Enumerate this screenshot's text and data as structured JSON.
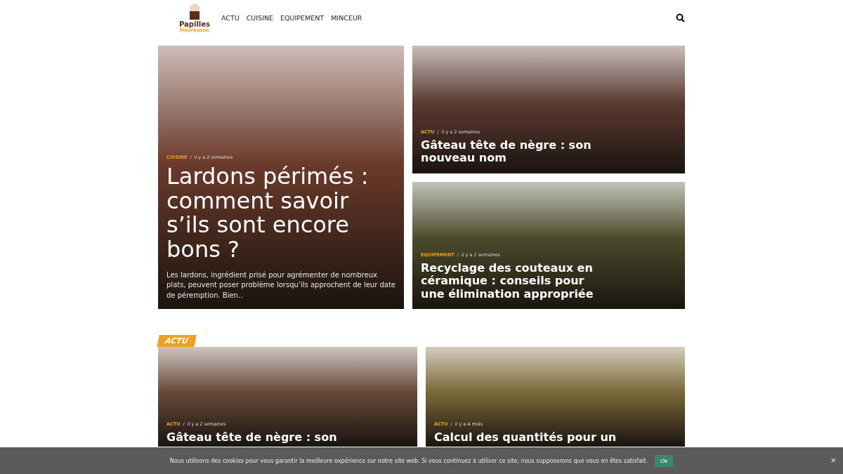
{
  "header": {
    "logo": {
      "line1": "Papilles",
      "line2": "Heureuses"
    },
    "nav": [
      {
        "label": "ACTU"
      },
      {
        "label": "CUISINE"
      },
      {
        "label": "EQUIPEMENT"
      },
      {
        "label": "MINCEUR"
      }
    ]
  },
  "featured": [
    {
      "category": "CUISINE",
      "separator": "/",
      "time": "il y a 2 semaines",
      "title": "Lardons périmés : comment savoir s’ils sont encore bons ?",
      "excerpt": "Les lardons, ingrédient prisé pour agrémenter de nombreux plats, peuvent poser problème lorsqu’ils approchent de leur date de péremption. Bien.."
    },
    {
      "category": "ACTU",
      "separator": "/",
      "time": "il y a 2 semaines",
      "title": "Gâteau tête de nègre : son nouveau nom"
    },
    {
      "category": "EQUIPEMENT",
      "separator": "/",
      "time": "il y a 2 semaines",
      "title": "Recyclage des couteaux en céramique : conseils pour une élimination appropriée"
    }
  ],
  "section": {
    "label": "ACTU",
    "posts": [
      {
        "category": "ACTU",
        "separator": "/",
        "time": "il y a 2 semaines",
        "title": "Gâteau tête de nègre : son"
      },
      {
        "category": "ACTU",
        "separator": "/",
        "time": "il y a 4 mois",
        "title": "Calcul des quantités pour un"
      }
    ]
  },
  "cookie_bar": {
    "text": "Nous utilisons des cookies pour vous garantir la meilleure expérience sur notre site web. Si vous continuez à utiliser ce site, nous supposerons que vous en êtes satisfait.",
    "button": "Ok",
    "close": "×"
  }
}
